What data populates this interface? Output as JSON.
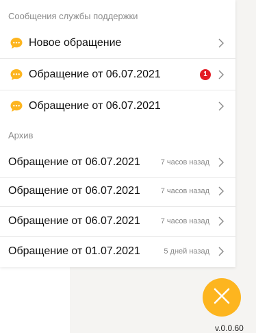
{
  "sections": {
    "active_title": "Сообщения службы поддержки",
    "archive_title": "Архив"
  },
  "active_items": [
    {
      "label": "Новое обращение",
      "icon": "chat-bubble-icon"
    },
    {
      "label": "Обращение от 06.07.2021",
      "icon": "chat-bubble-icon",
      "badge": "1"
    },
    {
      "label": "Обращение от 06.07.2021",
      "icon": "chat-bubble-icon"
    }
  ],
  "archive_items": [
    {
      "label": "Обращение от 06.07.2021",
      "meta": "7 часов назад"
    },
    {
      "label": "Обращение от 06.07.2021",
      "meta": "7 часов назад"
    },
    {
      "label": "Обращение от 06.07.2021",
      "meta": "7 часов назад"
    },
    {
      "label": "Обращение от 01.07.2021",
      "meta": "5 дней назад"
    }
  ],
  "fab": {
    "icon": "close-icon",
    "color": "#fdb51f"
  },
  "version": "v.0.0.60",
  "colors": {
    "badge": "#e31b23",
    "chat_icon": "#fdb51f"
  }
}
